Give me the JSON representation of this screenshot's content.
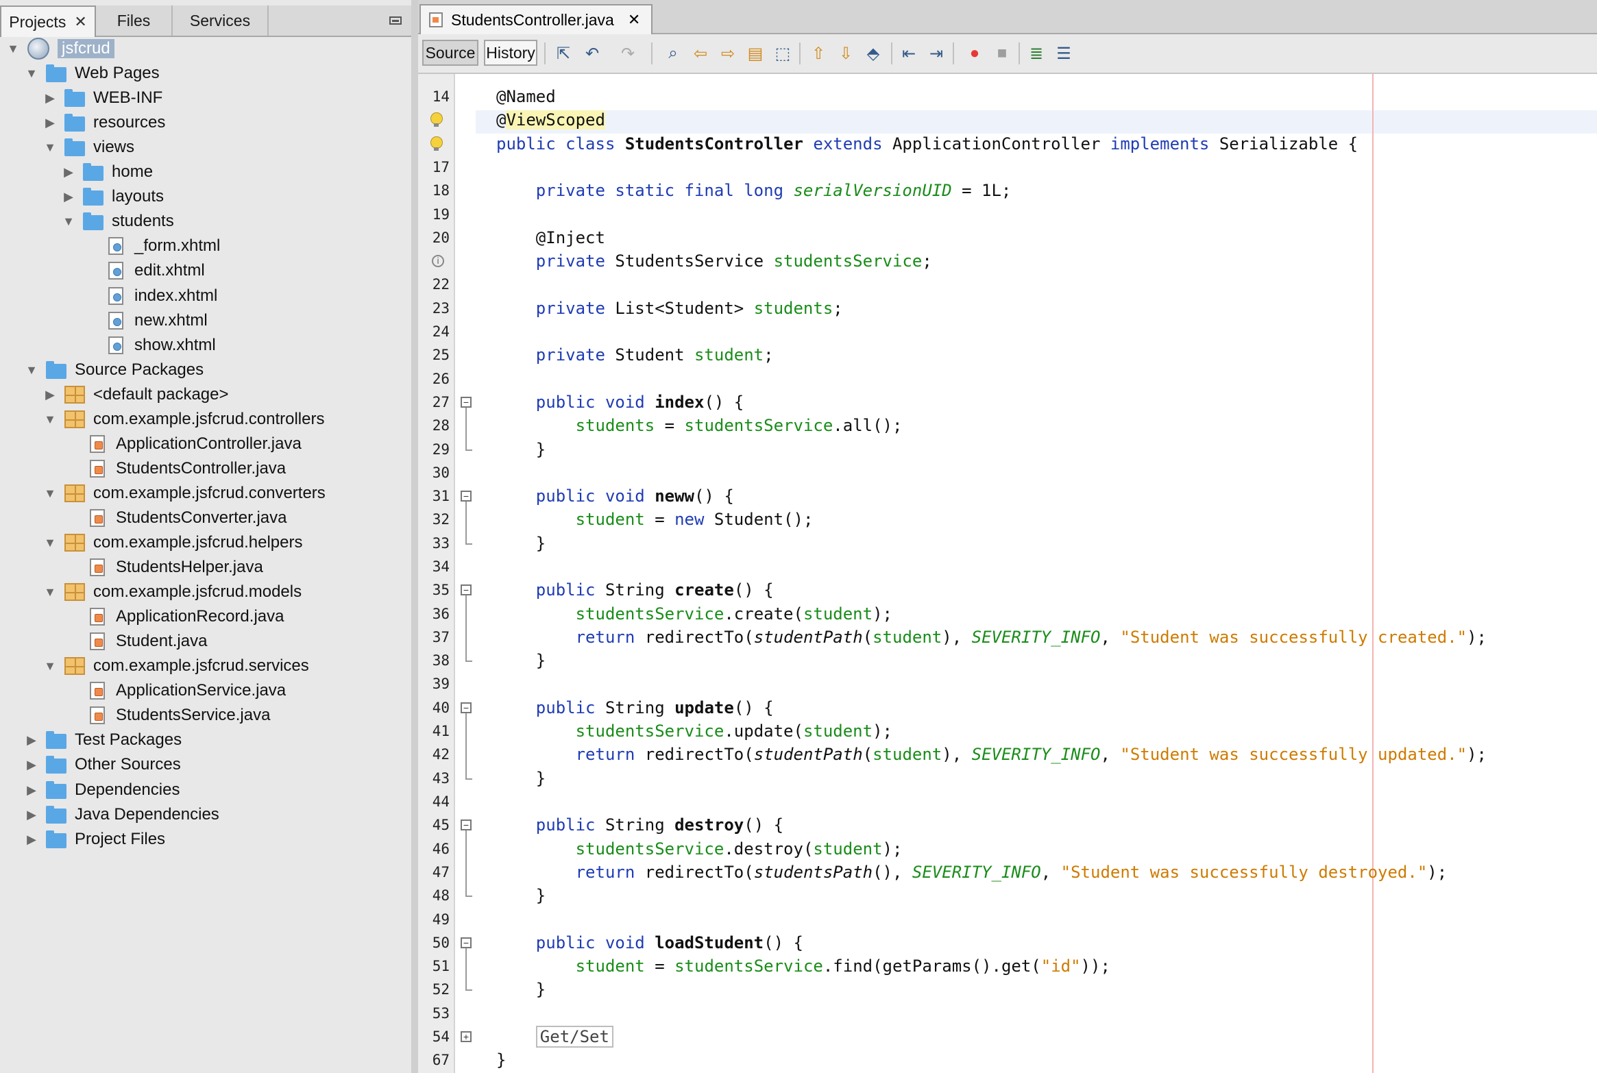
{
  "left_panel": {
    "tabs": [
      {
        "label": "Projects",
        "close": "✕"
      },
      {
        "label": "Files"
      },
      {
        "label": "Services"
      }
    ],
    "tree": [
      {
        "label": "jsfcrud",
        "type": "project",
        "expanded": true
      },
      {
        "label": "Web Pages",
        "type": "folder",
        "expanded": true
      },
      {
        "label": "WEB-INF",
        "type": "folder",
        "expanded": false
      },
      {
        "label": "resources",
        "type": "folder",
        "expanded": false
      },
      {
        "label": "views",
        "type": "folder",
        "expanded": true
      },
      {
        "label": "home",
        "type": "folder",
        "expanded": false
      },
      {
        "label": "layouts",
        "type": "folder",
        "expanded": false
      },
      {
        "label": "students",
        "type": "folder",
        "expanded": true
      },
      {
        "label": "_form.xhtml",
        "type": "file"
      },
      {
        "label": "edit.xhtml",
        "type": "file"
      },
      {
        "label": "index.xhtml",
        "type": "file"
      },
      {
        "label": "new.xhtml",
        "type": "file"
      },
      {
        "label": "show.xhtml",
        "type": "file"
      },
      {
        "label": "Source Packages",
        "type": "folder",
        "expanded": true
      },
      {
        "label": "<default package>",
        "type": "package",
        "expanded": false
      },
      {
        "label": "com.example.jsfcrud.controllers",
        "type": "package",
        "expanded": true
      },
      {
        "label": "ApplicationController.java",
        "type": "java"
      },
      {
        "label": "StudentsController.java",
        "type": "java"
      },
      {
        "label": "com.example.jsfcrud.converters",
        "type": "package",
        "expanded": true
      },
      {
        "label": "StudentsConverter.java",
        "type": "java"
      },
      {
        "label": "com.example.jsfcrud.helpers",
        "type": "package",
        "expanded": true
      },
      {
        "label": "StudentsHelper.java",
        "type": "java"
      },
      {
        "label": "com.example.jsfcrud.models",
        "type": "package",
        "expanded": true
      },
      {
        "label": "ApplicationRecord.java",
        "type": "java"
      },
      {
        "label": "Student.java",
        "type": "java"
      },
      {
        "label": "com.example.jsfcrud.services",
        "type": "package",
        "expanded": true
      },
      {
        "label": "ApplicationService.java",
        "type": "java"
      },
      {
        "label": "StudentsService.java",
        "type": "java"
      },
      {
        "label": "Test Packages",
        "type": "folder",
        "expanded": false
      },
      {
        "label": "Other Sources",
        "type": "folder",
        "expanded": false
      },
      {
        "label": "Dependencies",
        "type": "folder",
        "expanded": false
      },
      {
        "label": "Java Dependencies",
        "type": "folder",
        "expanded": false
      },
      {
        "label": "Project Files",
        "type": "folder",
        "expanded": false
      }
    ]
  },
  "editor": {
    "tab": {
      "label": "StudentsController.java",
      "close": "✕"
    },
    "toolbar": {
      "source_label": "Source",
      "history_label": "History"
    },
    "lines": [
      {
        "n": "14",
        "parts": [
          [
            "",
            "@Named"
          ]
        ]
      },
      {
        "n": "",
        "marker": "bulb",
        "current": true,
        "parts": [
          [
            "",
            "@"
          ],
          [
            "hl",
            "ViewScoped"
          ]
        ]
      },
      {
        "n": "",
        "marker": "bulb",
        "parts": [
          [
            "kw",
            "public class "
          ],
          [
            "bold",
            "StudentsController"
          ],
          [
            "kw",
            " extends "
          ],
          [
            "",
            "ApplicationController "
          ],
          [
            "kw",
            "implements "
          ],
          [
            "",
            "Serializable {"
          ]
        ]
      },
      {
        "n": "17",
        "parts": []
      },
      {
        "n": "18",
        "parts": [
          [
            "",
            "    "
          ],
          [
            "kw",
            "private static final long "
          ],
          [
            "fld ital",
            "serialVersionUID"
          ],
          [
            "",
            " = 1L;"
          ]
        ]
      },
      {
        "n": "19",
        "parts": []
      },
      {
        "n": "20",
        "parts": [
          [
            "",
            "    @Inject"
          ]
        ]
      },
      {
        "n": "",
        "marker": "info",
        "parts": [
          [
            "",
            "    "
          ],
          [
            "kw",
            "private "
          ],
          [
            "",
            "StudentsService "
          ],
          [
            "fld",
            "studentsService"
          ],
          [
            "",
            ";"
          ]
        ]
      },
      {
        "n": "22",
        "parts": []
      },
      {
        "n": "23",
        "parts": [
          [
            "",
            "    "
          ],
          [
            "kw",
            "private "
          ],
          [
            "",
            "List<Student> "
          ],
          [
            "fld",
            "students"
          ],
          [
            "",
            ";"
          ]
        ]
      },
      {
        "n": "24",
        "parts": []
      },
      {
        "n": "25",
        "parts": [
          [
            "",
            "    "
          ],
          [
            "kw",
            "private "
          ],
          [
            "",
            "Student "
          ],
          [
            "fld",
            "student"
          ],
          [
            "",
            ";"
          ]
        ]
      },
      {
        "n": "26",
        "parts": []
      },
      {
        "n": "27",
        "fold": "start",
        "parts": [
          [
            "",
            "    "
          ],
          [
            "kw",
            "public void "
          ],
          [
            "bold",
            "index"
          ],
          [
            "",
            "() {"
          ]
        ]
      },
      {
        "n": "28",
        "parts": [
          [
            "",
            "        "
          ],
          [
            "fld",
            "students"
          ],
          [
            "",
            " = "
          ],
          [
            "fld",
            "studentsService"
          ],
          [
            "",
            ".all();"
          ]
        ]
      },
      {
        "n": "29",
        "fold": "end",
        "parts": [
          [
            "",
            "    }"
          ]
        ]
      },
      {
        "n": "30",
        "parts": []
      },
      {
        "n": "31",
        "fold": "start",
        "parts": [
          [
            "",
            "    "
          ],
          [
            "kw",
            "public void "
          ],
          [
            "bold",
            "neww"
          ],
          [
            "",
            "() {"
          ]
        ]
      },
      {
        "n": "32",
        "parts": [
          [
            "",
            "        "
          ],
          [
            "fld",
            "student"
          ],
          [
            "",
            " = "
          ],
          [
            "kw",
            "new "
          ],
          [
            "",
            "Student();"
          ]
        ]
      },
      {
        "n": "33",
        "fold": "end",
        "parts": [
          [
            "",
            "    }"
          ]
        ]
      },
      {
        "n": "34",
        "parts": []
      },
      {
        "n": "35",
        "fold": "start",
        "parts": [
          [
            "",
            "    "
          ],
          [
            "kw",
            "public "
          ],
          [
            "",
            "String "
          ],
          [
            "bold",
            "create"
          ],
          [
            "",
            "() {"
          ]
        ]
      },
      {
        "n": "36",
        "parts": [
          [
            "",
            "        "
          ],
          [
            "fld",
            "studentsService"
          ],
          [
            "",
            ".create("
          ],
          [
            "fld",
            "student"
          ],
          [
            "",
            ");"
          ]
        ]
      },
      {
        "n": "37",
        "parts": [
          [
            "",
            "        "
          ],
          [
            "kw",
            "return "
          ],
          [
            "",
            "redirectTo("
          ],
          [
            "ital",
            "studentPath"
          ],
          [
            "",
            "("
          ],
          [
            "fld",
            "student"
          ],
          [
            "",
            "), "
          ],
          [
            "fld ital",
            "SEVERITY_INFO"
          ],
          [
            "",
            ", "
          ],
          [
            "str",
            "\"Student was successfully created.\""
          ],
          [
            "",
            ");"
          ]
        ]
      },
      {
        "n": "38",
        "fold": "end",
        "parts": [
          [
            "",
            "    }"
          ]
        ]
      },
      {
        "n": "39",
        "parts": []
      },
      {
        "n": "40",
        "fold": "start",
        "parts": [
          [
            "",
            "    "
          ],
          [
            "kw",
            "public "
          ],
          [
            "",
            "String "
          ],
          [
            "bold",
            "update"
          ],
          [
            "",
            "() {"
          ]
        ]
      },
      {
        "n": "41",
        "parts": [
          [
            "",
            "        "
          ],
          [
            "fld",
            "studentsService"
          ],
          [
            "",
            ".update("
          ],
          [
            "fld",
            "student"
          ],
          [
            "",
            ");"
          ]
        ]
      },
      {
        "n": "42",
        "parts": [
          [
            "",
            "        "
          ],
          [
            "kw",
            "return "
          ],
          [
            "",
            "redirectTo("
          ],
          [
            "ital",
            "studentPath"
          ],
          [
            "",
            "("
          ],
          [
            "fld",
            "student"
          ],
          [
            "",
            "), "
          ],
          [
            "fld ital",
            "SEVERITY_INFO"
          ],
          [
            "",
            ", "
          ],
          [
            "str",
            "\"Student was successfully updated.\""
          ],
          [
            "",
            ");"
          ]
        ]
      },
      {
        "n": "43",
        "fold": "end",
        "parts": [
          [
            "",
            "    }"
          ]
        ]
      },
      {
        "n": "44",
        "parts": []
      },
      {
        "n": "45",
        "fold": "start",
        "parts": [
          [
            "",
            "    "
          ],
          [
            "kw",
            "public "
          ],
          [
            "",
            "String "
          ],
          [
            "bold",
            "destroy"
          ],
          [
            "",
            "() {"
          ]
        ]
      },
      {
        "n": "46",
        "parts": [
          [
            "",
            "        "
          ],
          [
            "fld",
            "studentsService"
          ],
          [
            "",
            ".destroy("
          ],
          [
            "fld",
            "student"
          ],
          [
            "",
            ");"
          ]
        ]
      },
      {
        "n": "47",
        "parts": [
          [
            "",
            "        "
          ],
          [
            "kw",
            "return "
          ],
          [
            "",
            "redirectTo("
          ],
          [
            "ital",
            "studentsPath"
          ],
          [
            "",
            "(), "
          ],
          [
            "fld ital",
            "SEVERITY_INFO"
          ],
          [
            "",
            ", "
          ],
          [
            "str",
            "\"Student was successfully destroyed.\""
          ],
          [
            "",
            ");"
          ]
        ]
      },
      {
        "n": "48",
        "fold": "end",
        "parts": [
          [
            "",
            "    }"
          ]
        ]
      },
      {
        "n": "49",
        "parts": []
      },
      {
        "n": "50",
        "fold": "start",
        "parts": [
          [
            "",
            "    "
          ],
          [
            "kw",
            "public void "
          ],
          [
            "bold",
            "loadStudent"
          ],
          [
            "",
            "() {"
          ]
        ]
      },
      {
        "n": "51",
        "parts": [
          [
            "",
            "        "
          ],
          [
            "fld",
            "student"
          ],
          [
            "",
            " = "
          ],
          [
            "fld",
            "studentsService"
          ],
          [
            "",
            ".find(getParams().get("
          ],
          [
            "str",
            "\"id\""
          ],
          [
            "",
            "));"
          ]
        ]
      },
      {
        "n": "52",
        "fold": "end",
        "parts": [
          [
            "",
            "    }"
          ]
        ]
      },
      {
        "n": "53",
        "parts": []
      },
      {
        "n": "54",
        "fold": "collapsed",
        "parts": [
          [
            "",
            "    "
          ],
          [
            "getset",
            "Get/Set"
          ]
        ]
      },
      {
        "n": "67",
        "parts": [
          [
            "",
            "}"
          ]
        ]
      }
    ]
  }
}
